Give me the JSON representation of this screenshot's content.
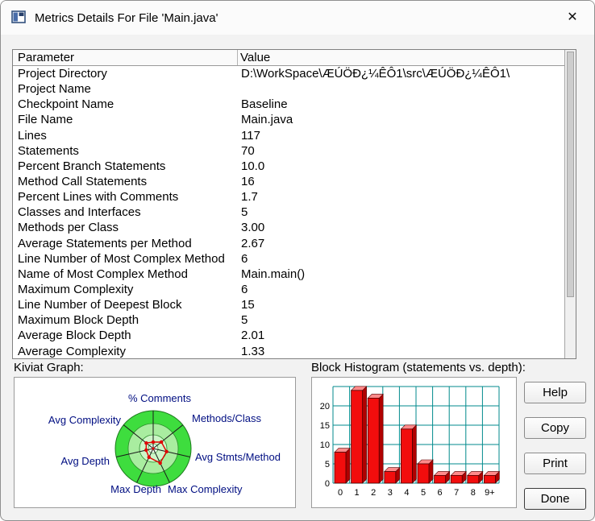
{
  "window": {
    "title": "Metrics Details For File 'Main.java'",
    "close_glyph": "✕"
  },
  "table": {
    "columns": [
      "Parameter",
      "Value"
    ],
    "rows": [
      {
        "param": "Project Directory",
        "value": "D:\\WorkSpace\\ÆÚÖÐ¿¼ÊÔ1\\src\\ÆÚÖÐ¿¼ÊÔ1\\"
      },
      {
        "param": "Project Name",
        "value": ""
      },
      {
        "param": "Checkpoint Name",
        "value": "Baseline"
      },
      {
        "param": "File Name",
        "value": "Main.java"
      },
      {
        "param": "Lines",
        "value": "117"
      },
      {
        "param": "Statements",
        "value": "70"
      },
      {
        "param": "Percent Branch Statements",
        "value": "10.0"
      },
      {
        "param": "Method Call Statements",
        "value": "16"
      },
      {
        "param": "Percent Lines with Comments",
        "value": "1.7"
      },
      {
        "param": "Classes and Interfaces",
        "value": "5"
      },
      {
        "param": "Methods per Class",
        "value": "3.00"
      },
      {
        "param": "Average Statements per Method",
        "value": "2.67"
      },
      {
        "param": "Line Number of Most Complex Method",
        "value": "6"
      },
      {
        "param": "Name of Most Complex Method",
        "value": "Main.main()"
      },
      {
        "param": "Maximum Complexity",
        "value": "6"
      },
      {
        "param": "Line Number of Deepest Block",
        "value": "15"
      },
      {
        "param": "Maximum Block Depth",
        "value": "5"
      },
      {
        "param": "Average Block Depth",
        "value": "2.01"
      },
      {
        "param": "Average Complexity",
        "value": "1.33"
      }
    ]
  },
  "kiviat": {
    "label": "Kiviat Graph:",
    "axes": [
      "% Comments",
      "Methods/Class",
      "Avg Stmts/Method",
      "Max Complexity",
      "Max Depth",
      "Avg Depth",
      "Avg Complexity"
    ]
  },
  "histogram": {
    "label": "Block Histogram (statements vs. depth):",
    "chart_data": {
      "type": "bar",
      "categories": [
        "0",
        "1",
        "2",
        "3",
        "4",
        "5",
        "6",
        "7",
        "8",
        "9+"
      ],
      "values": [
        8,
        24,
        22,
        3,
        14,
        5,
        2,
        2,
        2,
        2
      ],
      "title": "Block Histogram (statements vs. depth)",
      "xlabel": "depth",
      "ylabel": "statements",
      "ylim": [
        0,
        25
      ],
      "yticks": [
        0,
        5,
        10,
        15,
        20
      ],
      "grid": true,
      "bar_color": "#f20d0d",
      "bar_top_color": "#ff8a8a",
      "bar_side_color": "#b00000",
      "grid_color": "#008a8c"
    }
  },
  "buttons": {
    "help": "Help",
    "copy": "Copy",
    "print": "Print",
    "done": "Done"
  }
}
